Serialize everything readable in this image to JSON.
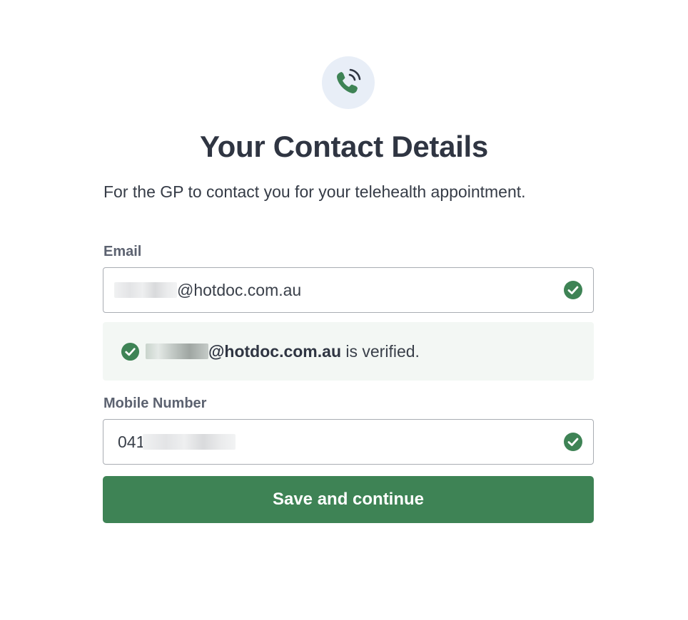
{
  "header": {
    "icon": "phone-call-icon",
    "title": "Your Contact Details",
    "subtitle": "For the GP to contact you for your telehealth appointment."
  },
  "email": {
    "label": "Email",
    "value_visible": "@hotdoc.com.au",
    "status_icon": "check-circle-icon"
  },
  "verification": {
    "icon": "check-circle-icon",
    "email_visible": "@hotdoc.com.au",
    "message": " is verified."
  },
  "mobile": {
    "label": "Mobile Number",
    "value_visible": "041",
    "status_icon": "check-circle-icon"
  },
  "actions": {
    "save_label": "Save and continue"
  },
  "colors": {
    "brand_green": "#3e8355",
    "icon_bg": "#e8eef7",
    "verified_bg": "#f3f7f4",
    "text_dark": "#2f3542"
  }
}
